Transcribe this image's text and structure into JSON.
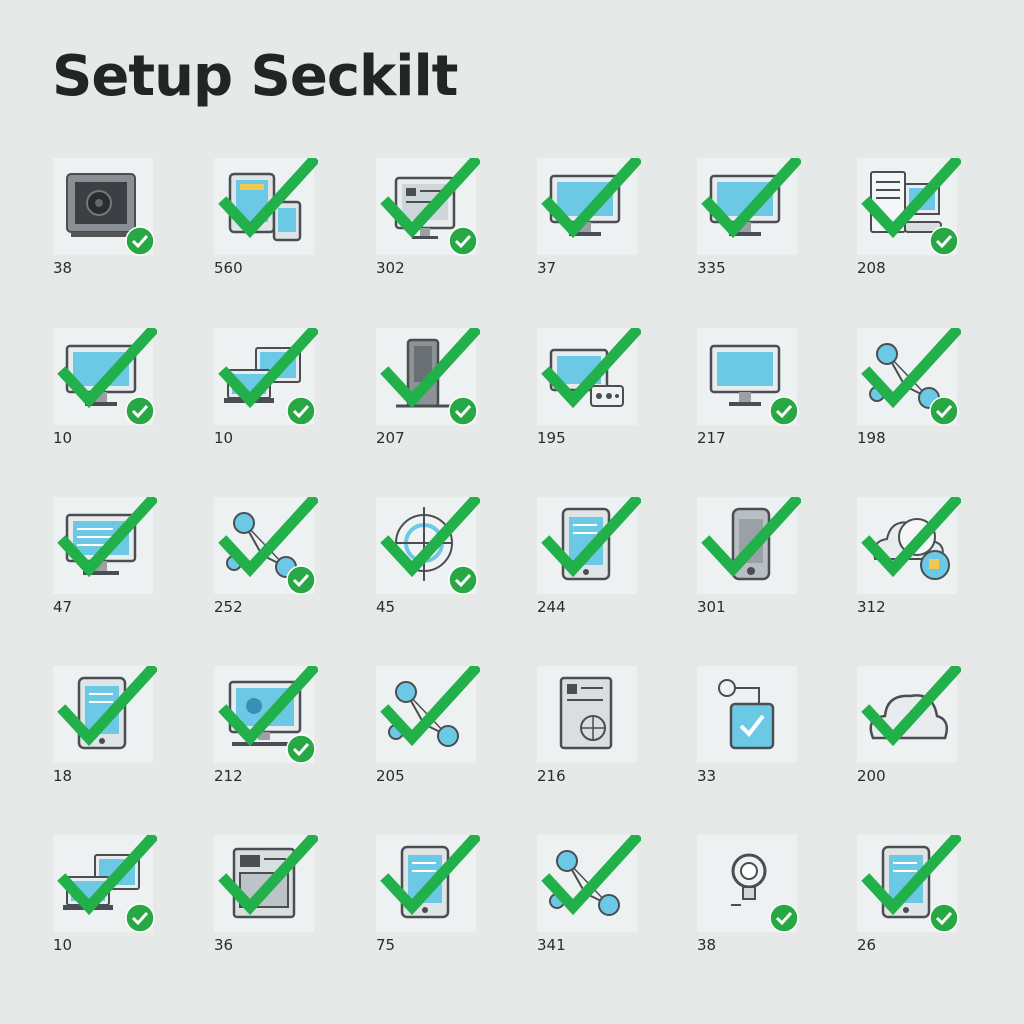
{
  "title": "Setup Seckilt",
  "colors": {
    "background": "#e6e9e8",
    "card": "#eef1f1",
    "check": "#22b04b",
    "badge": "#27a844",
    "screen": "#6cc9e6",
    "outline": "#4a4e52"
  },
  "items": [
    {
      "label": "38",
      "icon": "gpu-card-icon",
      "big_check": false,
      "badge": true
    },
    {
      "label": "560",
      "icon": "tablet-phone-icon",
      "big_check": true,
      "badge": false
    },
    {
      "label": "302",
      "icon": "monitor-doc-icon",
      "big_check": true,
      "badge": true
    },
    {
      "label": "37",
      "icon": "monitor-icon",
      "big_check": true,
      "badge": false
    },
    {
      "label": "335",
      "icon": "monitor-icon",
      "big_check": true,
      "badge": false
    },
    {
      "label": "208",
      "icon": "doc-monitor-icon",
      "big_check": true,
      "badge": true
    },
    {
      "label": "10",
      "icon": "monitor-icon",
      "big_check": true,
      "badge": true
    },
    {
      "label": "10",
      "icon": "desktop-laptop-icon",
      "big_check": true,
      "badge": true
    },
    {
      "label": "207",
      "icon": "tower-icon",
      "big_check": true,
      "badge": true
    },
    {
      "label": "195",
      "icon": "monitor-router-icon",
      "big_check": true,
      "badge": false
    },
    {
      "label": "217",
      "icon": "monitor-icon",
      "big_check": false,
      "badge": true
    },
    {
      "label": "198",
      "icon": "network-nodes-icon",
      "big_check": true,
      "badge": true
    },
    {
      "label": "47",
      "icon": "monitor-code-icon",
      "big_check": true,
      "badge": false
    },
    {
      "label": "252",
      "icon": "network-nodes-icon",
      "big_check": true,
      "badge": true
    },
    {
      "label": "45",
      "icon": "globe-icon",
      "big_check": true,
      "badge": true
    },
    {
      "label": "244",
      "icon": "tablet-icon",
      "big_check": true,
      "badge": false
    },
    {
      "label": "301",
      "icon": "phone-icon",
      "big_check": true,
      "badge": false
    },
    {
      "label": "312",
      "icon": "cloud-gauge-icon",
      "big_check": true,
      "badge": false
    },
    {
      "label": "18",
      "icon": "tablet-icon",
      "big_check": true,
      "badge": false
    },
    {
      "label": "212",
      "icon": "monitor-image-icon",
      "big_check": true,
      "badge": true
    },
    {
      "label": "205",
      "icon": "network-nodes-icon",
      "big_check": true,
      "badge": false
    },
    {
      "label": "216",
      "icon": "doc-globe-icon",
      "big_check": false,
      "badge": false
    },
    {
      "label": "33",
      "icon": "usb-drive-icon",
      "big_check": false,
      "badge": false
    },
    {
      "label": "200",
      "icon": "cloud-icon",
      "big_check": true,
      "badge": false
    },
    {
      "label": "10",
      "icon": "desktop-laptop-icon",
      "big_check": true,
      "badge": true
    },
    {
      "label": "36",
      "icon": "doc-image-icon",
      "big_check": true,
      "badge": false
    },
    {
      "label": "75",
      "icon": "tablet-icon",
      "big_check": true,
      "badge": false
    },
    {
      "label": "341",
      "icon": "network-nodes-icon",
      "big_check": true,
      "badge": false
    },
    {
      "label": "38",
      "icon": "lightbulb-icon",
      "big_check": false,
      "badge": true
    },
    {
      "label": "26",
      "icon": "tablet-icon",
      "big_check": true,
      "badge": true
    }
  ]
}
